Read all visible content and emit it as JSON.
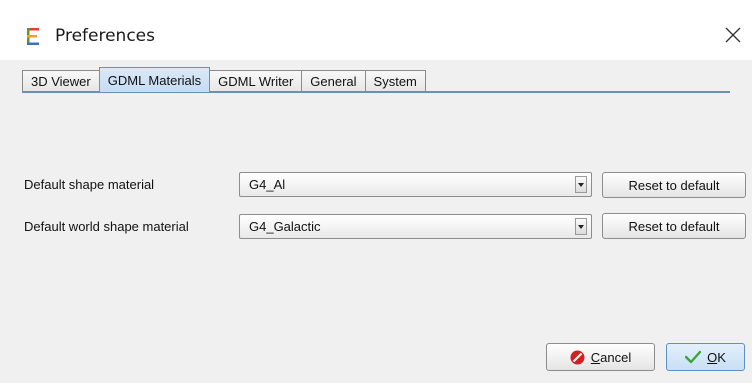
{
  "window": {
    "title": "Preferences",
    "app_icon": "eclipse-e-icon",
    "close_icon": "close-icon"
  },
  "tabs": [
    {
      "label": "3D Viewer",
      "active": false
    },
    {
      "label": "GDML Materials",
      "active": true
    },
    {
      "label": "GDML Writer",
      "active": false
    },
    {
      "label": "General",
      "active": false
    },
    {
      "label": "System",
      "active": false
    }
  ],
  "settings": [
    {
      "label": "Default shape material",
      "value": "G4_Al",
      "reset_label": "Reset to default"
    },
    {
      "label": "Default world shape material",
      "value": "G4_Galactic",
      "reset_label": "Reset to default"
    }
  ],
  "footer": {
    "cancel": {
      "mnemonic": "C",
      "rest": "ancel",
      "icon": "cancel-icon"
    },
    "ok": {
      "mnemonic": "O",
      "rest": "K",
      "icon": "checkmark-icon"
    }
  },
  "colors": {
    "accent": "#6c8fb7",
    "cancel_red": "#d21f1f",
    "ok_green": "#3aa53a"
  }
}
